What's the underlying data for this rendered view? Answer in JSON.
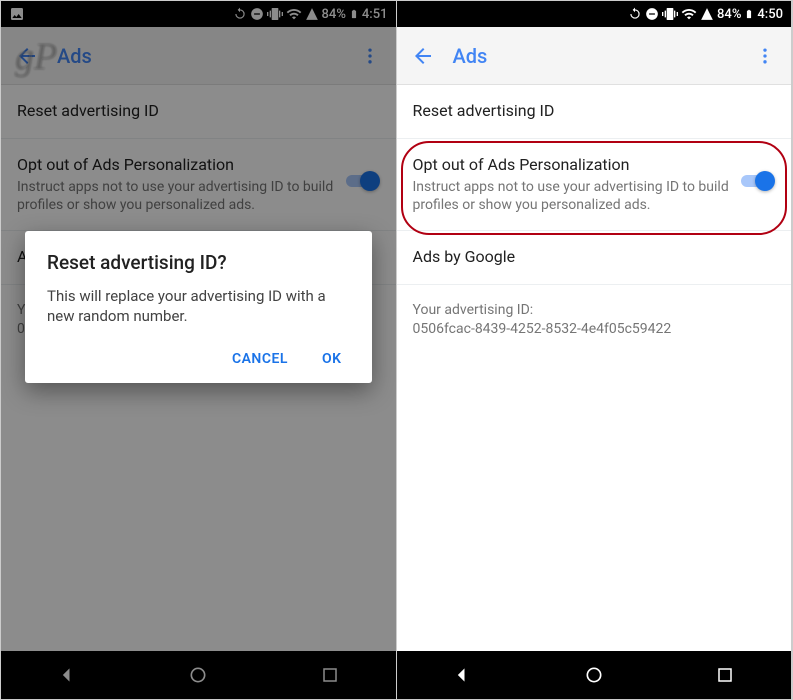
{
  "left": {
    "status": {
      "battery": "84%",
      "time": "4:51"
    },
    "title": "Ads",
    "watermark": "gP",
    "rows": {
      "reset": {
        "title": "Reset advertising ID"
      },
      "optout": {
        "title": "Opt out of Ads Personalization",
        "sub": "Instruct apps not to use your advertising ID to build profiles or show you personalized ads."
      },
      "adsby": {
        "title": "A"
      }
    },
    "info": {
      "label": "Y",
      "value": "0"
    },
    "dialog": {
      "title": "Reset advertising ID?",
      "body": "This will replace your advertising ID with a new random number.",
      "cancel": "Cancel",
      "ok": "OK"
    }
  },
  "right": {
    "status": {
      "battery": "84%",
      "time": "4:50"
    },
    "title": "Ads",
    "rows": {
      "reset": {
        "title": "Reset advertising ID"
      },
      "optout": {
        "title": "Opt out of Ads Personalization",
        "sub": "Instruct apps not to use your advertising ID to build profiles or show you personalized ads."
      },
      "adsby": {
        "title": "Ads by Google"
      }
    },
    "info": {
      "label": "Your advertising ID:",
      "value": "0506fcac-8439-4252-8532-4e4f05c59422"
    }
  }
}
